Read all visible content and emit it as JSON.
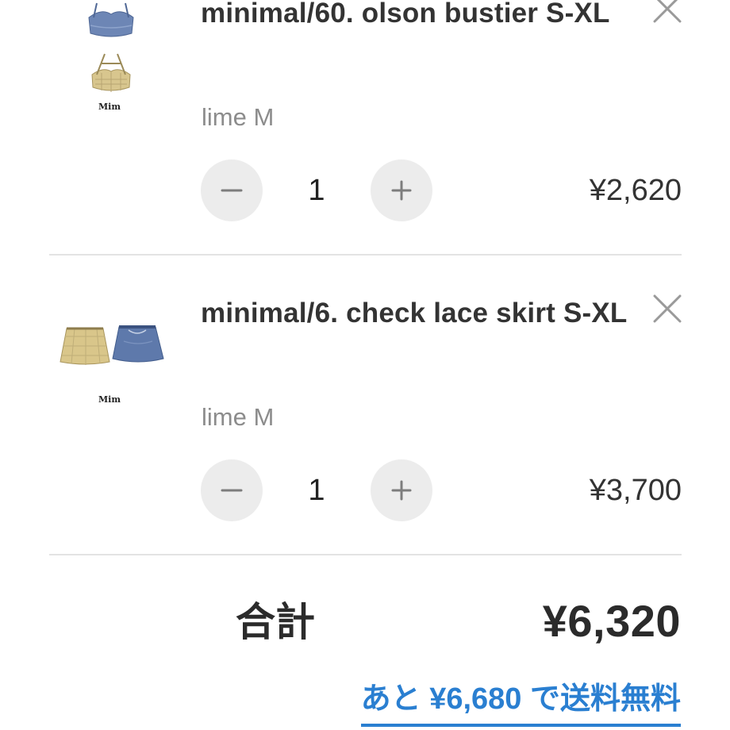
{
  "cart": {
    "items": [
      {
        "title": "minimal/60. olson bustier S-XL",
        "variant": "lime M",
        "quantity": "1",
        "price": "¥2,620",
        "brand_mark": "Mim",
        "icons": {
          "decrease": "minus-icon",
          "increase": "plus-icon",
          "remove": "close-icon"
        }
      },
      {
        "title": "minimal/6. check lace skirt S-XL",
        "variant": "lime M",
        "quantity": "1",
        "price": "¥3,700",
        "brand_mark": "Mim",
        "icons": {
          "decrease": "minus-icon",
          "increase": "plus-icon",
          "remove": "close-icon"
        }
      }
    ],
    "total_label": "合計",
    "total_value": "¥6,320",
    "free_shipping_note": "あと ¥6,680 で送料無料"
  },
  "colors": {
    "accent": "#2a7fd1",
    "text": "#333333",
    "muted": "#8c8c8c",
    "button_bg": "#ececec",
    "divider": "#e3e3e3"
  }
}
